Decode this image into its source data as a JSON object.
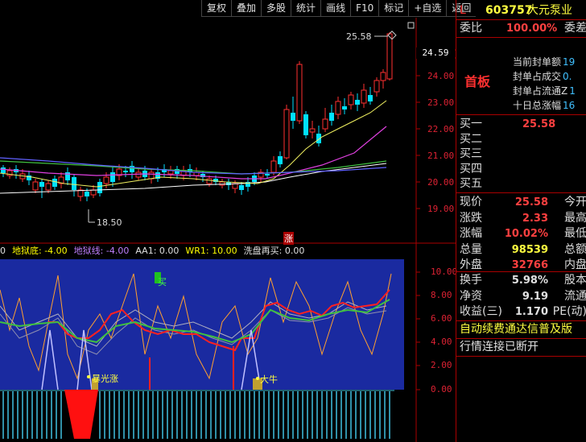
{
  "toolbar": [
    "复权",
    "叠加",
    "多股",
    "统计",
    "画线",
    "F10",
    "标记",
    "+自选",
    "返回"
  ],
  "chart": {
    "price_axis": [
      "19.00",
      "20.00",
      "21.00",
      "22.00",
      "23.00",
      "24.00"
    ],
    "current_price_tag": "24.59",
    "high_label": "25.58",
    "low_label": "18.50",
    "zhang_mark": "涨"
  },
  "indicator": {
    "legend": [
      {
        "text": "0",
        "color": "#e0e0e0"
      },
      {
        "text": "地狱底: -4.00",
        "color": "#ffff00"
      },
      {
        "text": "地狱线: -4.00",
        "color": "#c080ff"
      },
      {
        "text": "AA1: 0.00",
        "color": "#e0e0e0"
      },
      {
        "text": "WR1: 10.00",
        "color": "#ffff00"
      },
      {
        "text": "洗盘再买: 0.00",
        "color": "#e0e0e0"
      }
    ],
    "axis": [
      "10.00",
      "8.00",
      "6.00",
      "4.00",
      "2.00",
      "0.00"
    ],
    "labels": {
      "buy": "买",
      "surge": "暴光涨",
      "bull": "大牛"
    }
  },
  "quote": {
    "badge": "L",
    "code": "603757",
    "name": "大元泵业",
    "weibi_label": "委比",
    "weibi_value": "100.00%",
    "weicha_label": "委差",
    "board": "首板",
    "board_items": [
      {
        "label": "当前封单额",
        "value": "19"
      },
      {
        "label": "封单占成交",
        "value": "0."
      },
      {
        "label": "封单占流通Z",
        "value": "1"
      },
      {
        "label": "十日总涨幅",
        "value": "16"
      }
    ],
    "book": [
      {
        "label": "买一",
        "value": "25.58"
      },
      {
        "label": "买二",
        "value": ""
      },
      {
        "label": "买三",
        "value": ""
      },
      {
        "label": "买四",
        "value": ""
      },
      {
        "label": "买五",
        "value": ""
      }
    ],
    "stats": [
      {
        "label": "现价",
        "value": "25.58",
        "label2": "今开",
        "color": "red"
      },
      {
        "label": "涨跌",
        "value": "2.33",
        "label2": "最高",
        "color": "red"
      },
      {
        "label": "涨幅",
        "value": "10.02%",
        "label2": "最低",
        "color": "red"
      },
      {
        "label": "总量",
        "value": "98539",
        "label2": "总额",
        "color": "yellow"
      },
      {
        "label": "外盘",
        "value": "32766",
        "label2": "内盘",
        "color": "red"
      }
    ],
    "stats2": [
      {
        "label": "换手",
        "value": "5.98%",
        "label2": "股本"
      },
      {
        "label": "净资",
        "value": "9.19",
        "label2": "流通"
      },
      {
        "label": "收益(三)",
        "value": "1.170",
        "label2": "PE(动)"
      }
    ],
    "notice1": "自动续费通达信普及版",
    "notice2": "行情连接已断开"
  }
}
